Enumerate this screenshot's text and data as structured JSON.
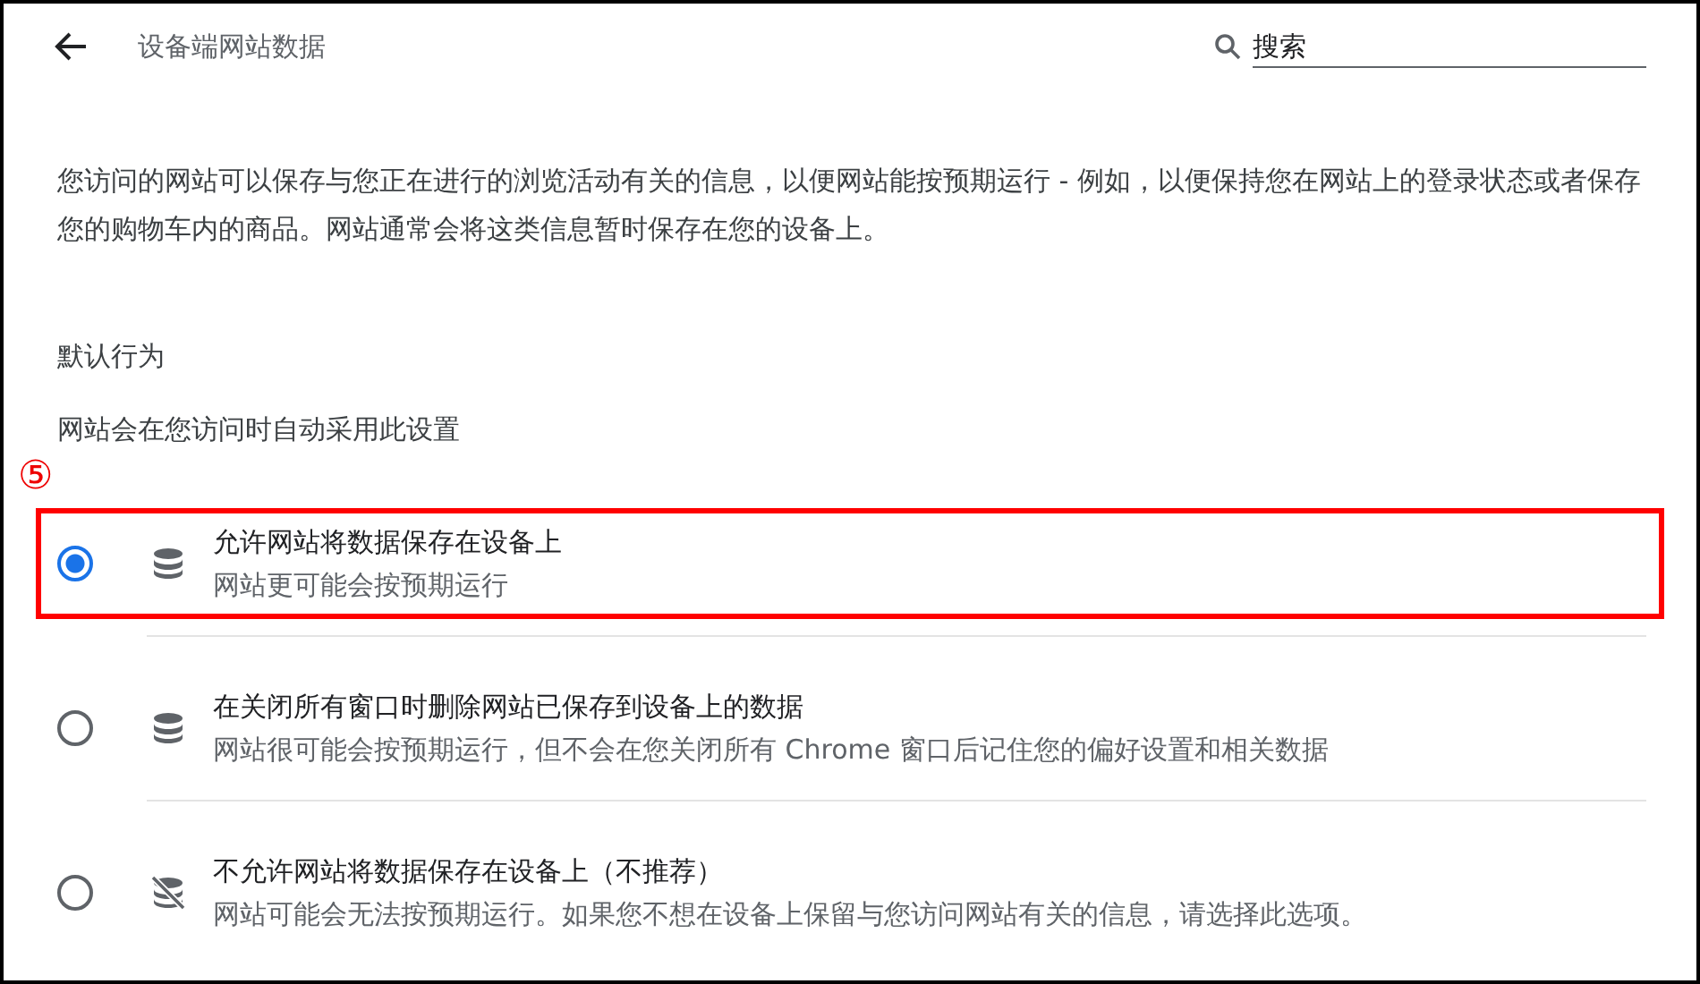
{
  "header": {
    "title": "设备端网站数据",
    "search": {
      "placeholder": "搜索"
    }
  },
  "description": "您访问的网站可以保存与您正在进行的浏览活动有关的信息，以便网站能按预期运行 - 例如，以便保持您在网站上的登录状态或者保存您的购物车内的商品。网站通常会将这类信息暂时保存在您的设备上。",
  "section_title": "默认行为",
  "section_subtitle": "网站会在您访问时自动采用此设置",
  "annotation": {
    "label": "⑤"
  },
  "options": [
    {
      "kind": "allow",
      "label": "允许网站将数据保存在设备上",
      "sublabel": "网站更可能会按预期运行",
      "selected": true,
      "highlighted": true
    },
    {
      "kind": "allow",
      "label": "在关闭所有窗口时删除网站已保存到设备上的数据",
      "sublabel": "网站很可能会按预期运行，但不会在您关闭所有 Chrome 窗口后记住您的偏好设置和相关数据",
      "selected": false,
      "highlighted": false
    },
    {
      "kind": "block",
      "label": "不允许网站将数据保存在设备上（不推荐）",
      "sublabel": "网站可能会无法按预期运行。如果您不想在设备上保留与您访问网站有关的信息，请选择此选项。",
      "selected": false,
      "highlighted": false
    }
  ]
}
